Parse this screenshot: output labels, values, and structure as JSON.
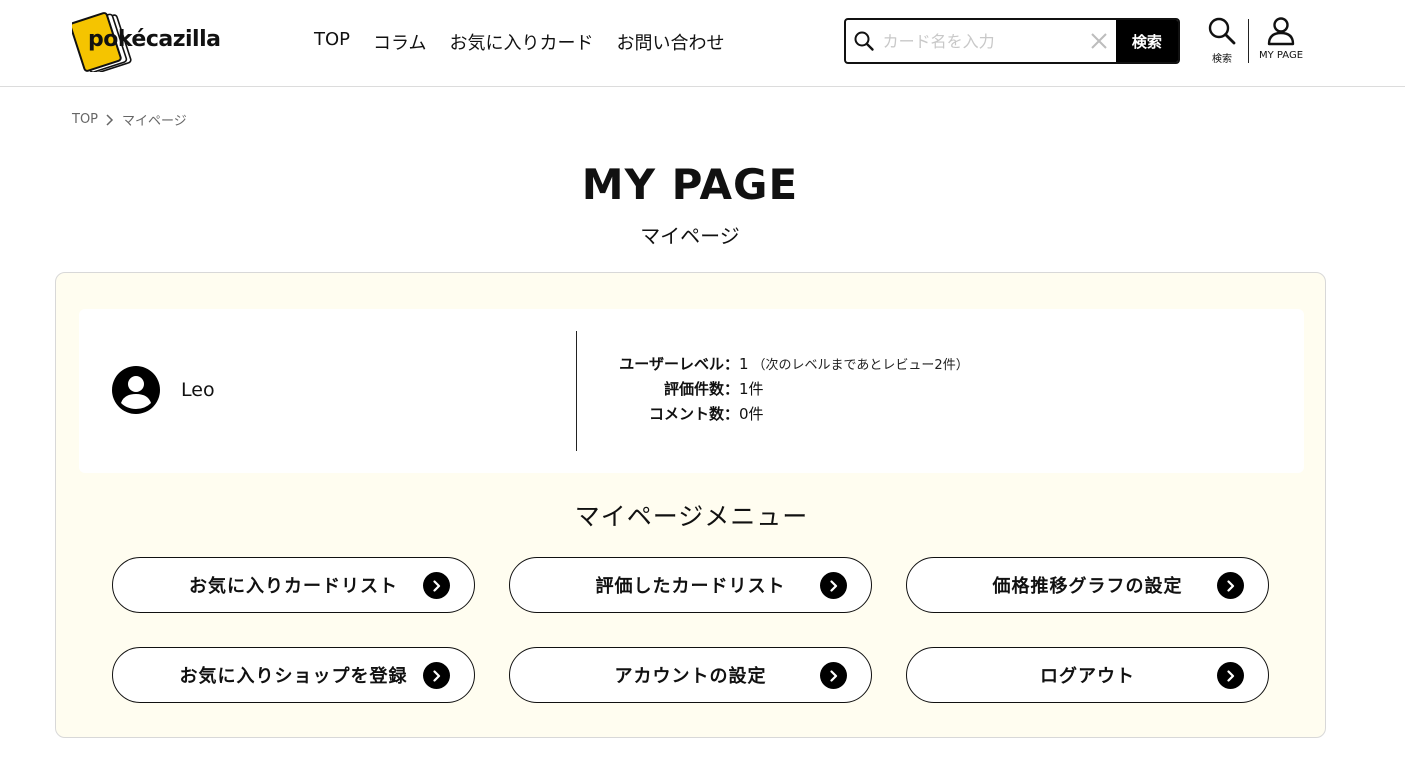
{
  "header": {
    "logo_text": "pokécazilla",
    "nav": [
      "TOP",
      "コラム",
      "お気に入りカード",
      "お問い合わせ"
    ],
    "search": {
      "placeholder": "カード名を入力",
      "button_label": "検索"
    },
    "icon_search_caption": "検索",
    "icon_mypage_caption": "MY PAGE"
  },
  "breadcrumb": {
    "home": "TOP",
    "current": "マイページ"
  },
  "page": {
    "title": "MY PAGE",
    "subtitle": "マイページ"
  },
  "profile": {
    "username": "Leo",
    "stats": [
      {
        "label": "ユーザーレベル：",
        "value": "1",
        "note": "（次のレベルまであとレビュー2件）"
      },
      {
        "label": "評価件数：",
        "value": "1件"
      },
      {
        "label": "コメント数：",
        "value": "0件"
      }
    ]
  },
  "menu": {
    "title": "マイページメニュー",
    "items": [
      "お気に入りカードリスト",
      "評価したカードリスト",
      "価格推移グラフの設定",
      "お気に入りショップを登録",
      "アカウントの設定",
      "ログアウト"
    ]
  },
  "colors": {
    "accent": "#f5c400",
    "panel_bg": "#fffdf0",
    "text": "#111111"
  }
}
